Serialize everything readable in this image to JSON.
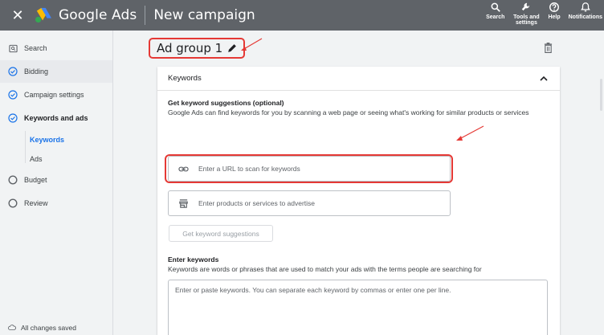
{
  "topbar": {
    "close_icon": "close-icon",
    "brand": "Google Ads",
    "title": "New campaign",
    "actions": [
      {
        "label": "Search",
        "icon": "search-icon"
      },
      {
        "label": "Tools and settings",
        "icon": "wrench-icon"
      },
      {
        "label": "Help",
        "icon": "help-icon"
      },
      {
        "label": "Notifications",
        "icon": "bell-icon"
      }
    ]
  },
  "sidebar": {
    "items": [
      {
        "label": "Search",
        "icon": "campaign-type-icon"
      },
      {
        "label": "Bidding",
        "icon": "check-circle-icon",
        "state": "done"
      },
      {
        "label": "Campaign settings",
        "icon": "check-circle-icon",
        "state": "done"
      },
      {
        "label": "Keywords and ads",
        "icon": "check-circle-icon",
        "state": "current"
      },
      {
        "label": "Budget",
        "icon": "empty-circle-icon",
        "state": "todo"
      },
      {
        "label": "Review",
        "icon": "empty-circle-icon",
        "state": "todo"
      }
    ],
    "subitems": [
      {
        "label": "Keywords",
        "active": true
      },
      {
        "label": "Ads",
        "active": false
      }
    ],
    "footer": "All changes saved"
  },
  "main": {
    "ad_group_title": "Ad group 1",
    "card": {
      "header": "Keywords",
      "suggestions_title": "Get keyword suggestions (optional)",
      "suggestions_desc": "Google Ads can find keywords for you by scanning a web page or seeing what's working for similar products or services",
      "url_placeholder": "Enter a URL to scan for keywords",
      "products_placeholder": "Enter products or services to advertise",
      "get_suggestions_label": "Get keyword suggestions",
      "enter_title": "Enter keywords",
      "enter_desc": "Keywords are words or phrases that are used to match your ads with the terms people are searching for",
      "textarea_placeholder": "Enter or paste keywords. You can separate each keyword by commas or enter one per line."
    }
  },
  "colors": {
    "topbar": "#5f6368",
    "accent": "#1a73e8",
    "annotation": "#e53935"
  }
}
